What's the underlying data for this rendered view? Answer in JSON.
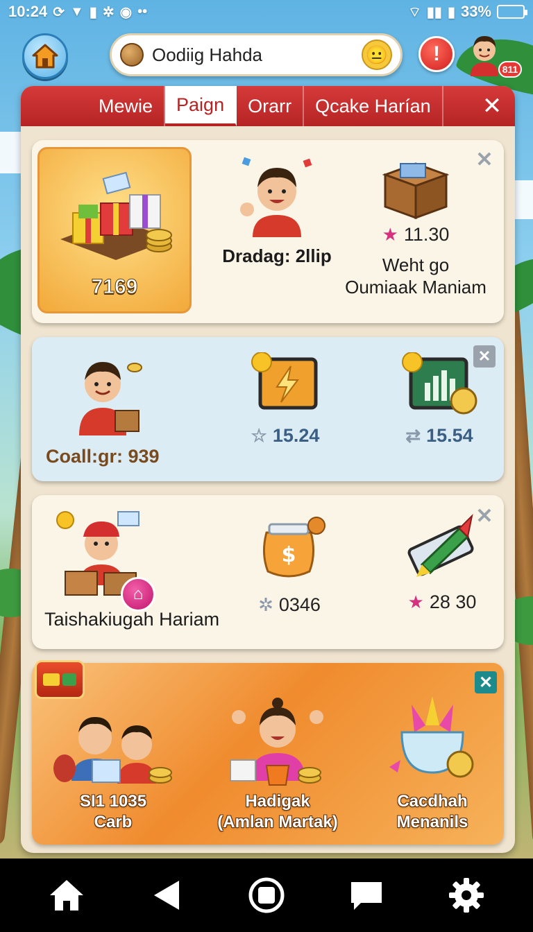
{
  "status_bar": {
    "time": "10:24",
    "battery": "33%"
  },
  "topbar": {
    "search_text": "Oodiig Hahda",
    "alert_label": "!",
    "avatar_badge": "811"
  },
  "tabs": [
    {
      "label": "Mewie",
      "active": false
    },
    {
      "label": "Paign",
      "active": true
    },
    {
      "label": "Orarr",
      "active": false
    },
    {
      "label": "Qcake Harían",
      "active": false
    }
  ],
  "cards": {
    "c1": {
      "tile_value": "7169",
      "item1_label": "Dradag: 2llip",
      "item2_value": "11.30",
      "item2_label_line1": "Weht go",
      "item2_label_line2": "Oumiaak Maniam"
    },
    "c2": {
      "item1_label": "Coall:gr: 939",
      "item2_value": "15.24",
      "item3_value": "15.54"
    },
    "c3": {
      "item1_label": "Taishakiugah Hariam",
      "item2_value": "0346",
      "item3_value": "28 30"
    },
    "c4": {
      "item1_line1": "SI1 1035",
      "item1_line2": "Carb",
      "item2_line1": "Hadigak",
      "item2_line2": "(Amlan Martak)",
      "item3_line1": "Cacdhah",
      "item3_line2": "Menanils"
    }
  },
  "icons": {
    "home": "home-icon",
    "back": "back-icon",
    "recents": "recents-icon",
    "chat": "chat-icon",
    "settings": "gear-icon"
  },
  "colors": {
    "tab_bar": "#c62f2f",
    "accent_pink": "#d6317f",
    "panel": "#efe4cf"
  }
}
